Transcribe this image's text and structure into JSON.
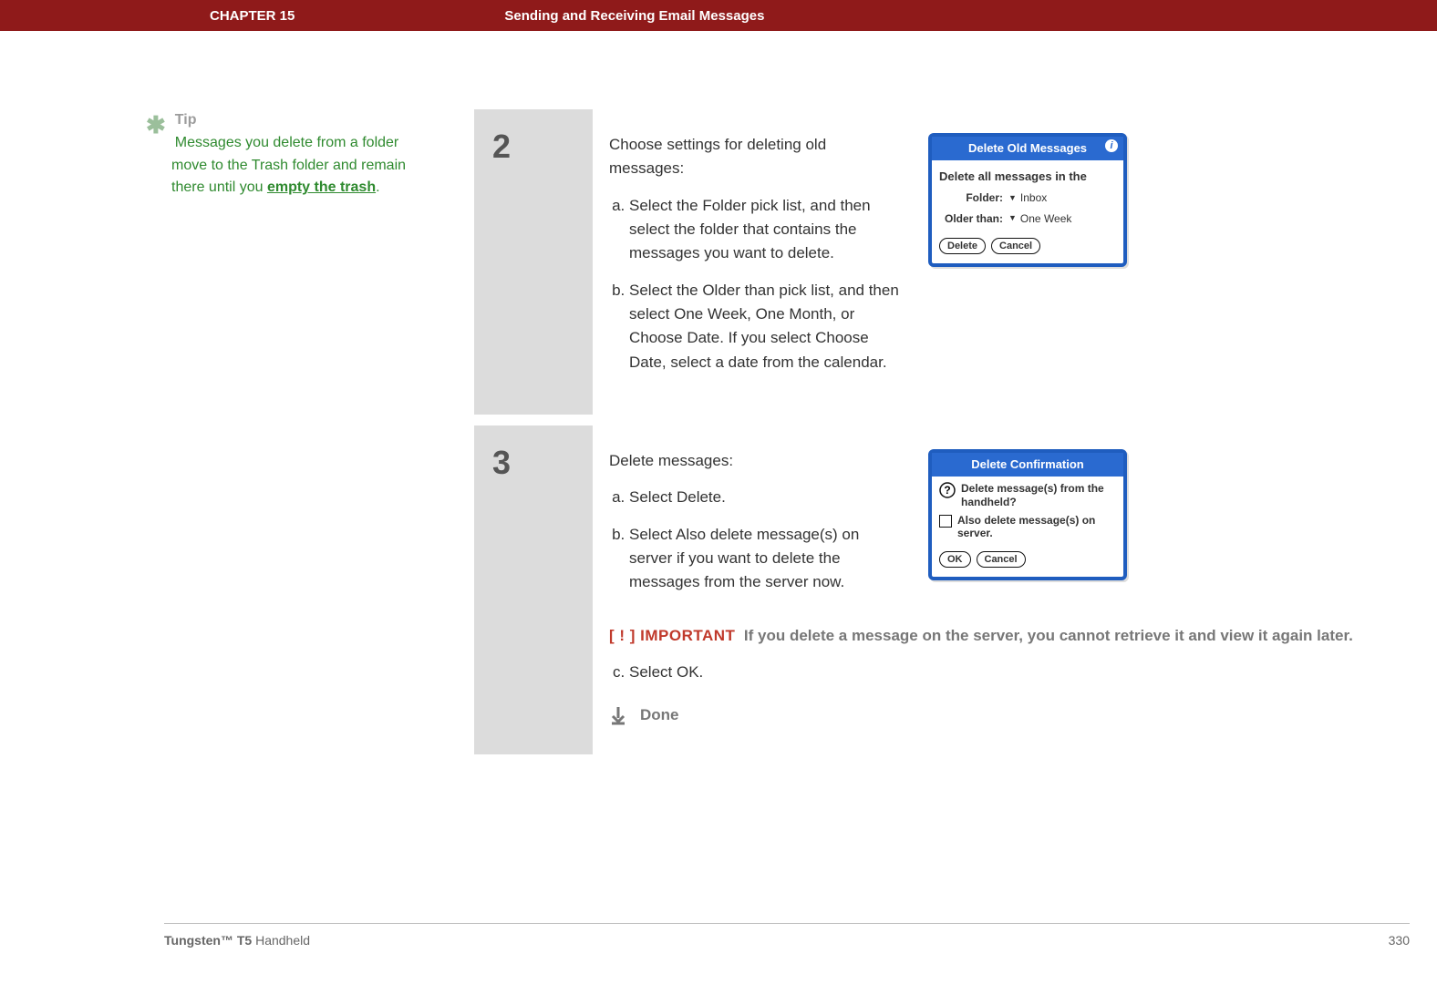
{
  "header": {
    "chapter": "CHAPTER 15",
    "title": "Sending and Receiving Email Messages"
  },
  "tip": {
    "heading": "Tip",
    "body_pre": "Messages you delete from a folder move to the Trash folder and remain there until you ",
    "link_text": "empty the trash",
    "body_post": "."
  },
  "step2": {
    "number": "2",
    "lead": "Choose settings for deleting old messages:",
    "items": [
      "Select the Folder pick list, and then select the folder that contains the messages you want to delete.",
      "Select the Older than pick list, and then select One Week, One Month, or Choose Date. If you select Choose Date, select a date from the calendar."
    ],
    "dialog": {
      "title": "Delete Old Messages",
      "subhead": "Delete all messages in the",
      "folder_label": "Folder:",
      "folder_value": "Inbox",
      "older_label": "Older than:",
      "older_value": "One Week",
      "btn_delete": "Delete",
      "btn_cancel": "Cancel"
    }
  },
  "step3": {
    "number": "3",
    "lead": "Delete messages:",
    "items_ab": [
      "Select Delete.",
      "Select Also delete message(s) on server if you want to delete the messages from the server now."
    ],
    "important_label": "[ ! ] IMPORTANT",
    "important_text": "If you delete a message on the server, you cannot retrieve it and view it again later.",
    "item_c": "Select OK.",
    "done": "Done",
    "dialog": {
      "title": "Delete Confirmation",
      "question": "Delete message(s) from the handheld?",
      "checkbox_label": "Also delete message(s) on server.",
      "btn_ok": "OK",
      "btn_cancel": "Cancel"
    }
  },
  "footer": {
    "product_bold": "Tungsten™ T5",
    "product_rest": " Handheld",
    "page": "330"
  }
}
